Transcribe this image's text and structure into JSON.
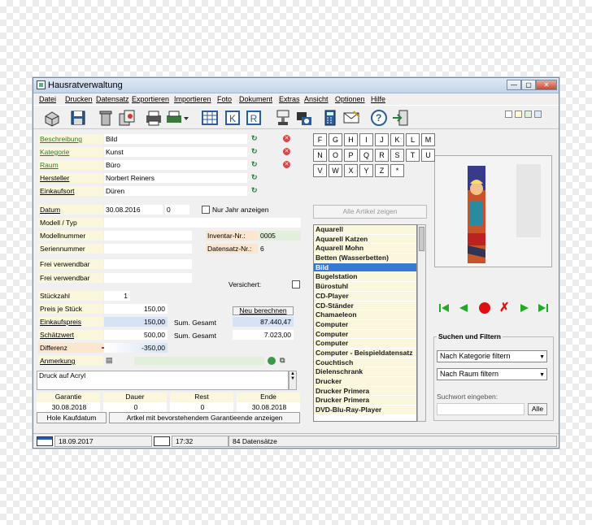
{
  "window": {
    "title": "Hausratverwaltung",
    "min": "—",
    "max": "▢",
    "close": "✕"
  },
  "menu": [
    "Datei",
    "Drucken",
    "Datensatz",
    "Exportieren",
    "Importieren",
    "Foto",
    "Dokument",
    "Extras",
    "Ansicht",
    "Optionen",
    "Hilfe"
  ],
  "toolbar": {
    "k1": "K",
    "k2": "R"
  },
  "form": {
    "beschreibung": {
      "label": "Beschreibung",
      "value": "Bild"
    },
    "kategorie": {
      "label": "Kategorie",
      "value": "Kunst"
    },
    "raum": {
      "label": "Raum",
      "value": "Büro"
    },
    "hersteller": {
      "label": "Hersteller",
      "value": "Norbert Reiners"
    },
    "einkaufsort": {
      "label": "Einkaufsort",
      "value": "Düren"
    },
    "datum": {
      "label": "Datum",
      "value": "30.08.2016",
      "extra": "0"
    },
    "nur_jahr": "Nur Jahr anzeigen",
    "modell_typ": {
      "label": "Modell / Typ",
      "value": ""
    },
    "modellnummer": {
      "label": "Modellnummer",
      "value": ""
    },
    "seriennummer": {
      "label": "Seriennummer",
      "value": ""
    },
    "frei1": {
      "label": "Frei verwendbar",
      "value": ""
    },
    "frei2": {
      "label": "Frei verwendbar",
      "value": ""
    },
    "inventar": {
      "label": "Inventar-Nr.:",
      "value": "0005"
    },
    "datensatz": {
      "label": "Datensatz-Nr.:",
      "value": "6"
    },
    "versichert": "Versichert:",
    "stueckzahl": {
      "label": "Stückzahl",
      "value": "1"
    },
    "preis": {
      "label": "Preis je Stück",
      "value": "150,00"
    },
    "einkaufspreis": {
      "label": "Einkaufspreis",
      "value": "150,00"
    },
    "schaetzwert": {
      "label": "Schätzwert",
      "value": "500,00"
    },
    "differenz": {
      "label": "Differenz",
      "value": "-350,00"
    },
    "sum1": {
      "label": "Sum. Gesamt",
      "value": "87.440,47"
    },
    "sum2": {
      "label": "Sum. Gesamt",
      "value": "7.023,00"
    },
    "neu_berechnen": "Neu berechnen",
    "anmerkung": {
      "label": "Anmerkung",
      "value": ""
    },
    "notiz": "Druck auf Acryl"
  },
  "garantie": {
    "headers": [
      "Garantie",
      "Dauer",
      "Rest",
      "Ende"
    ],
    "values": [
      "30.08.2018",
      "0",
      "0",
      "30.08.2018"
    ],
    "btn1": "Hole Kaufdatum",
    "btn2": "Artkel mit bevorstehendem Garantieende anzeigen"
  },
  "keys": [
    "F",
    "G",
    "H",
    "I",
    "J",
    "K",
    "L",
    "M",
    "N",
    "O",
    "P",
    "Q",
    "R",
    "S",
    "T",
    "U",
    "V",
    "W",
    "X",
    "Y",
    "Z",
    "*"
  ],
  "alle_artikel": "Alle Artikel zeigen",
  "list": [
    "Aquarell",
    "Aquarell Katzen",
    "Aquarell Mohn",
    "Betten (Wasserbetten)",
    "Bild",
    "Bugelstation",
    "Bürostuhl",
    "CD-Player",
    "CD-Ständer",
    "Chamaeleon",
    "Computer",
    "Computer",
    "Computer",
    "Computer - Beispieldatensatz",
    "Couchtisch",
    "Dielenschrank",
    "Drucker",
    "Drucker Primera",
    "Drucker Primera",
    "DVD-Blu-Ray-Player"
  ],
  "selected_index": 4,
  "search": {
    "title": "Suchen und Filtern",
    "filter1": "Nach Kategorie filtern",
    "filter2": "Nach Raum filtern",
    "suchwort": "Suchwort eingeben:",
    "alle": "Alle"
  },
  "status": {
    "date": "18.09.2017",
    "time": "17:32",
    "count": "84 Datensätze"
  },
  "colors": {
    "nav_green": "#22aa33",
    "nav_red": "#dd1111",
    "selection": "#3a78d8"
  }
}
